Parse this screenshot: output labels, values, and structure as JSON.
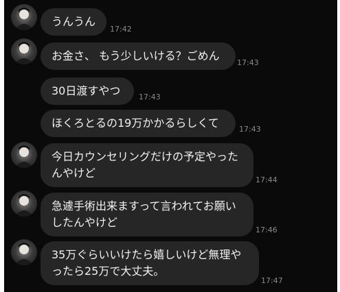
{
  "messages": [
    {
      "text": "うんうん",
      "time": "17:42",
      "avatar": "profile-avatar"
    },
    {
      "text": "お金さ、 もう少しいける？ごめん",
      "time": "17:43",
      "avatar": "profile-avatar"
    },
    {
      "text": "30日渡すやつ",
      "time": "17:43"
    },
    {
      "text": "ほくろとるの19万かかるらしくて",
      "time": "17:43"
    },
    {
      "text": "今日カウンセリングだけの予定やった\nんやけど",
      "time": "17:44",
      "avatar": "profile-avatar"
    },
    {
      "text": "急遽手術出来ますって言われてお願い\nしたんやけど",
      "time": "17:46",
      "avatar": "profile-avatar"
    },
    {
      "text": "35万ぐらいいけたら嬉しいけど無理や\nったら25万で大丈夫。",
      "time": "17:47",
      "avatar": "profile-avatar"
    }
  ]
}
